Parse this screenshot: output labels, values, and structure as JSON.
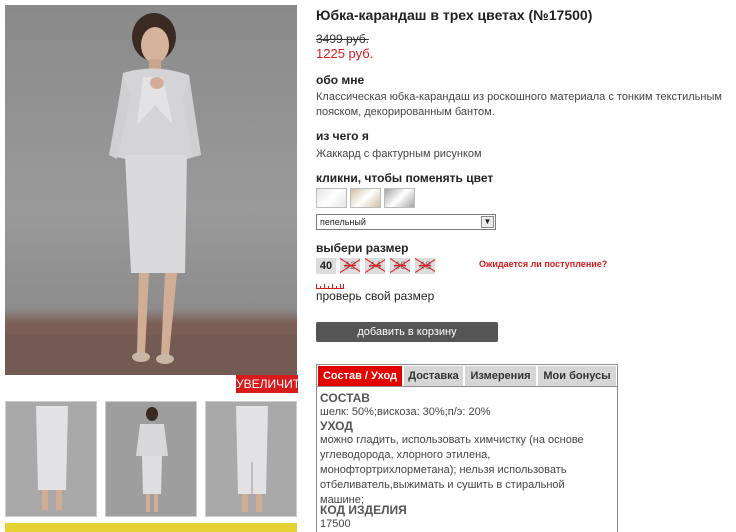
{
  "product": {
    "title": "Юбка-карандаш в трех цветах (№17500)",
    "old_price": "3499 руб.",
    "price": "1225 руб."
  },
  "about": {
    "heading": "обо мне",
    "text": "Классическая юбка-карандаш из роскошного материала с тонким текстильным пояском, декорированным бантом."
  },
  "material": {
    "heading": "из чего я",
    "text": "Жаккард с фактурным рисунком"
  },
  "color": {
    "heading": "кликни, чтобы поменять цвет",
    "selected": "пепельный",
    "arrow": "▼",
    "swatches": [
      {
        "name": "pale",
        "color": "#e4e4e4"
      },
      {
        "name": "beige",
        "color": "#cfbf9f"
      },
      {
        "name": "grey",
        "color": "#a6a6a6"
      }
    ]
  },
  "size": {
    "heading": "выбери размер",
    "options": [
      "40",
      "42",
      "44",
      "46",
      "48"
    ],
    "ask_link": "Ожидается ли поступление?",
    "check_link": "проверь свой размер"
  },
  "gallery": {
    "zoom_label": "УВЕЛИЧИТЬ"
  },
  "cart": {
    "button": "добавить в корзину"
  },
  "tabs": [
    {
      "label": "Состав / Уход"
    },
    {
      "label": "Доставка"
    },
    {
      "label": "Измерения"
    },
    {
      "label": "Мои бонусы"
    }
  ],
  "panel": {
    "composition_heading": "СОСТАВ",
    "composition_text": "шелк: 50%;вискоза: 30%;п/э: 20%",
    "care_heading": "УХОД",
    "care_text": "можно гладить, использовать химчистку (на основе углеводорода, хлорного этилена, монофтортрихлорметана); нельзя использовать отбеливатель,выжимать и сушить в стиральной машине;",
    "code_heading": "КОД ИЗДЕЛИЯ",
    "code_value": "17500"
  },
  "colors": {
    "accent": "#d81b1b",
    "tab_active": "#e50000",
    "button": "#555555",
    "thumb_strip": "#e6d232"
  }
}
